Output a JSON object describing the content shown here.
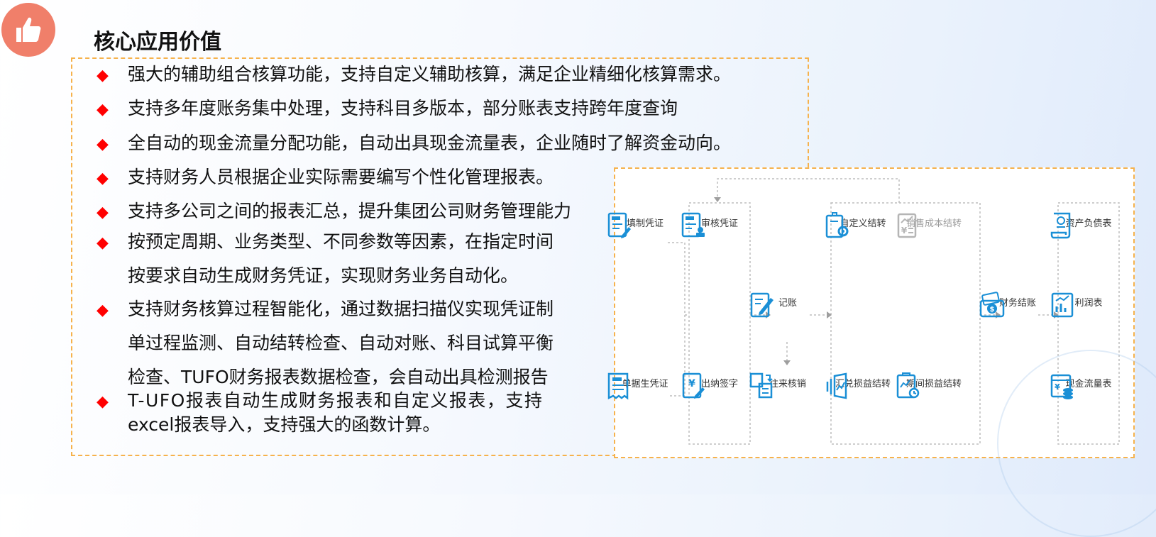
{
  "header": {
    "title": "核心应用价值"
  },
  "bullets": [
    {
      "lines": [
        "强大的辅助组合核算功能，支持自定义辅助核算，满足企业精细化核算需求。"
      ]
    },
    {
      "lines": [
        "支持多年度账务集中处理，支持科目多版本，部分账表支持跨年度查询"
      ]
    },
    {
      "lines": [
        "全自动的现金流量分配功能，自动出具现金流量表，企业随时了解资金动向。"
      ]
    },
    {
      "lines": [
        "支持财务人员根据企业实际需要编写个性化管理报表。"
      ]
    },
    {
      "lines": [
        "支持多公司之间的报表汇总，提升集团公司财务管理能力"
      ]
    },
    {
      "lines": [
        "按预定周期、业务类型、不同参数等因素，在指定时间",
        "按要求自动生成财务凭证，实现财务业务自动化。"
      ]
    },
    {
      "lines": [
        "支持财务核算过程智能化，通过数据扫描仪实现凭证制",
        "单过程监测、自动结转检查、自动对账、科目试算平衡",
        "检查、TUFO财务报表数据检查，会自动出具检测报告"
      ]
    },
    {
      "lines": [
        "T-UFO报表自动生成财务报表和自定义报表，支持",
        "excel报表导入，支持强大的函数计算。"
      ]
    }
  ],
  "flow": {
    "nodes": {
      "fill_voucher": "填制凭证",
      "bill_voucher": "单据生凭证",
      "review_voucher": "审核凭证",
      "cashier_sign": "出纳签字",
      "post": "记账",
      "reconcile": "往来核销",
      "custom_transfer": "自定义结转",
      "sales_cost_transfer": "销售成本结转",
      "fx_transfer": "汇兑损益结转",
      "period_transfer": "期间损益结转",
      "closing": "财务结账",
      "balance_sheet": "资产负债表",
      "income_statement": "利润表",
      "cashflow_statement": "现金流量表"
    }
  },
  "colors": {
    "accent": "#1a8fd6",
    "bullet": "#ff0000",
    "dashed_border": "#f6b24c",
    "badge": "#f07f6a"
  }
}
